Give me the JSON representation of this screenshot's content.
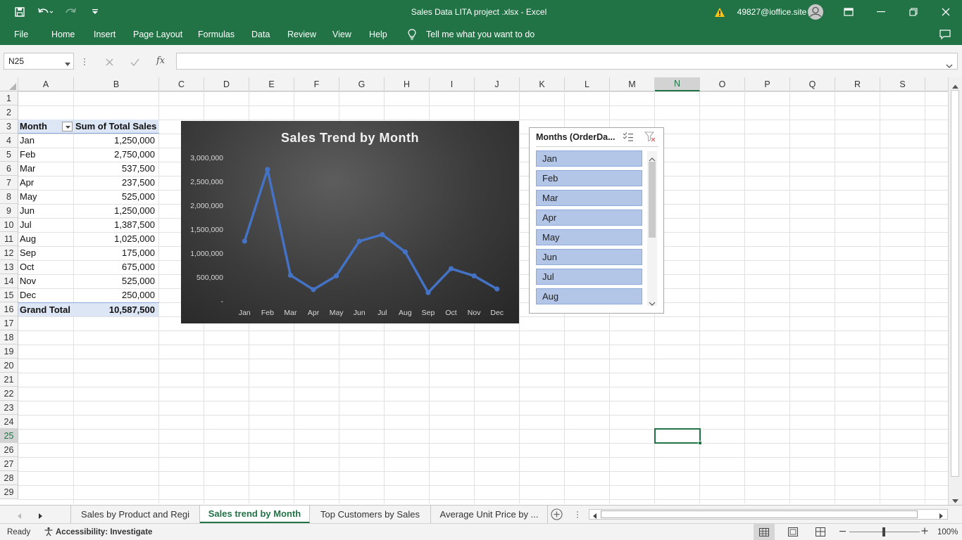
{
  "window": {
    "title": "Sales Data LITA project .xlsx  -  Excel",
    "user": "49827@ioffice.site"
  },
  "ribbon": {
    "tabs": [
      "File",
      "Home",
      "Insert",
      "Page Layout",
      "Formulas",
      "Data",
      "Review",
      "View",
      "Help"
    ],
    "tell_me": "Tell me what you want to do"
  },
  "formula_bar": {
    "name_box": "N25",
    "fx": "fx",
    "value": ""
  },
  "columns": [
    "A",
    "B",
    "C",
    "D",
    "E",
    "F",
    "G",
    "H",
    "I",
    "J",
    "K",
    "L",
    "M",
    "N",
    "O",
    "P",
    "Q",
    "R",
    "S"
  ],
  "selected_column": "N",
  "rows": [
    "1",
    "2",
    "3",
    "4",
    "5",
    "6",
    "7",
    "8",
    "9",
    "10",
    "11",
    "12",
    "13",
    "14",
    "15",
    "16",
    "17",
    "18",
    "19",
    "20",
    "21",
    "22",
    "23",
    "24",
    "25",
    "26",
    "27",
    "28",
    "29"
  ],
  "selected_row": "25",
  "pivot": {
    "header_month": "Month",
    "header_sales": "Sum of Total Sales",
    "rows": [
      {
        "month": "Jan",
        "sales": "1,250,000"
      },
      {
        "month": "Feb",
        "sales": "2,750,000"
      },
      {
        "month": "Mar",
        "sales": "537,500"
      },
      {
        "month": "Apr",
        "sales": "237,500"
      },
      {
        "month": "May",
        "sales": "525,000"
      },
      {
        "month": "Jun",
        "sales": "1,250,000"
      },
      {
        "month": "Jul",
        "sales": "1,387,500"
      },
      {
        "month": "Aug",
        "sales": "1,025,000"
      },
      {
        "month": "Sep",
        "sales": "175,000"
      },
      {
        "month": "Oct",
        "sales": "675,000"
      },
      {
        "month": "Nov",
        "sales": "525,000"
      },
      {
        "month": "Dec",
        "sales": "250,000"
      }
    ],
    "total_label": "Grand Total",
    "total_value": "10,587,500"
  },
  "chart_data": {
    "type": "line",
    "title": "Sales Trend by Month",
    "categories": [
      "Jan",
      "Feb",
      "Mar",
      "Apr",
      "May",
      "Jun",
      "Jul",
      "Aug",
      "Sep",
      "Oct",
      "Nov",
      "Dec"
    ],
    "values": [
      1250000,
      2750000,
      537500,
      237500,
      525000,
      1250000,
      1387500,
      1025000,
      175000,
      675000,
      525000,
      250000
    ],
    "ylim": [
      0,
      3000000
    ],
    "yticks": [
      "-",
      "500,000",
      "1,000,000",
      "1,500,000",
      "2,000,000",
      "2,500,000",
      "3,000,000"
    ],
    "grid": false,
    "colors": {
      "line": "#4472c4",
      "background": "#3a3a3a"
    }
  },
  "slicer": {
    "title": "Months (OrderDa...",
    "items": [
      "Jan",
      "Feb",
      "Mar",
      "Apr",
      "May",
      "Jun",
      "Jul",
      "Aug"
    ]
  },
  "sheets": {
    "tabs": [
      "Sales by Product and Regi",
      "Sales trend by Month",
      "Top Customers by Sales",
      "Average Unit Price by  ..."
    ],
    "active": "Sales trend by Month"
  },
  "status": {
    "mode": "Ready",
    "accessibility": "Accessibility: Investigate",
    "zoom": "100%"
  },
  "colors": {
    "excel_green": "#217346",
    "pivot_band": "#dde6f4",
    "slicer_item": "#b4c6e7"
  }
}
